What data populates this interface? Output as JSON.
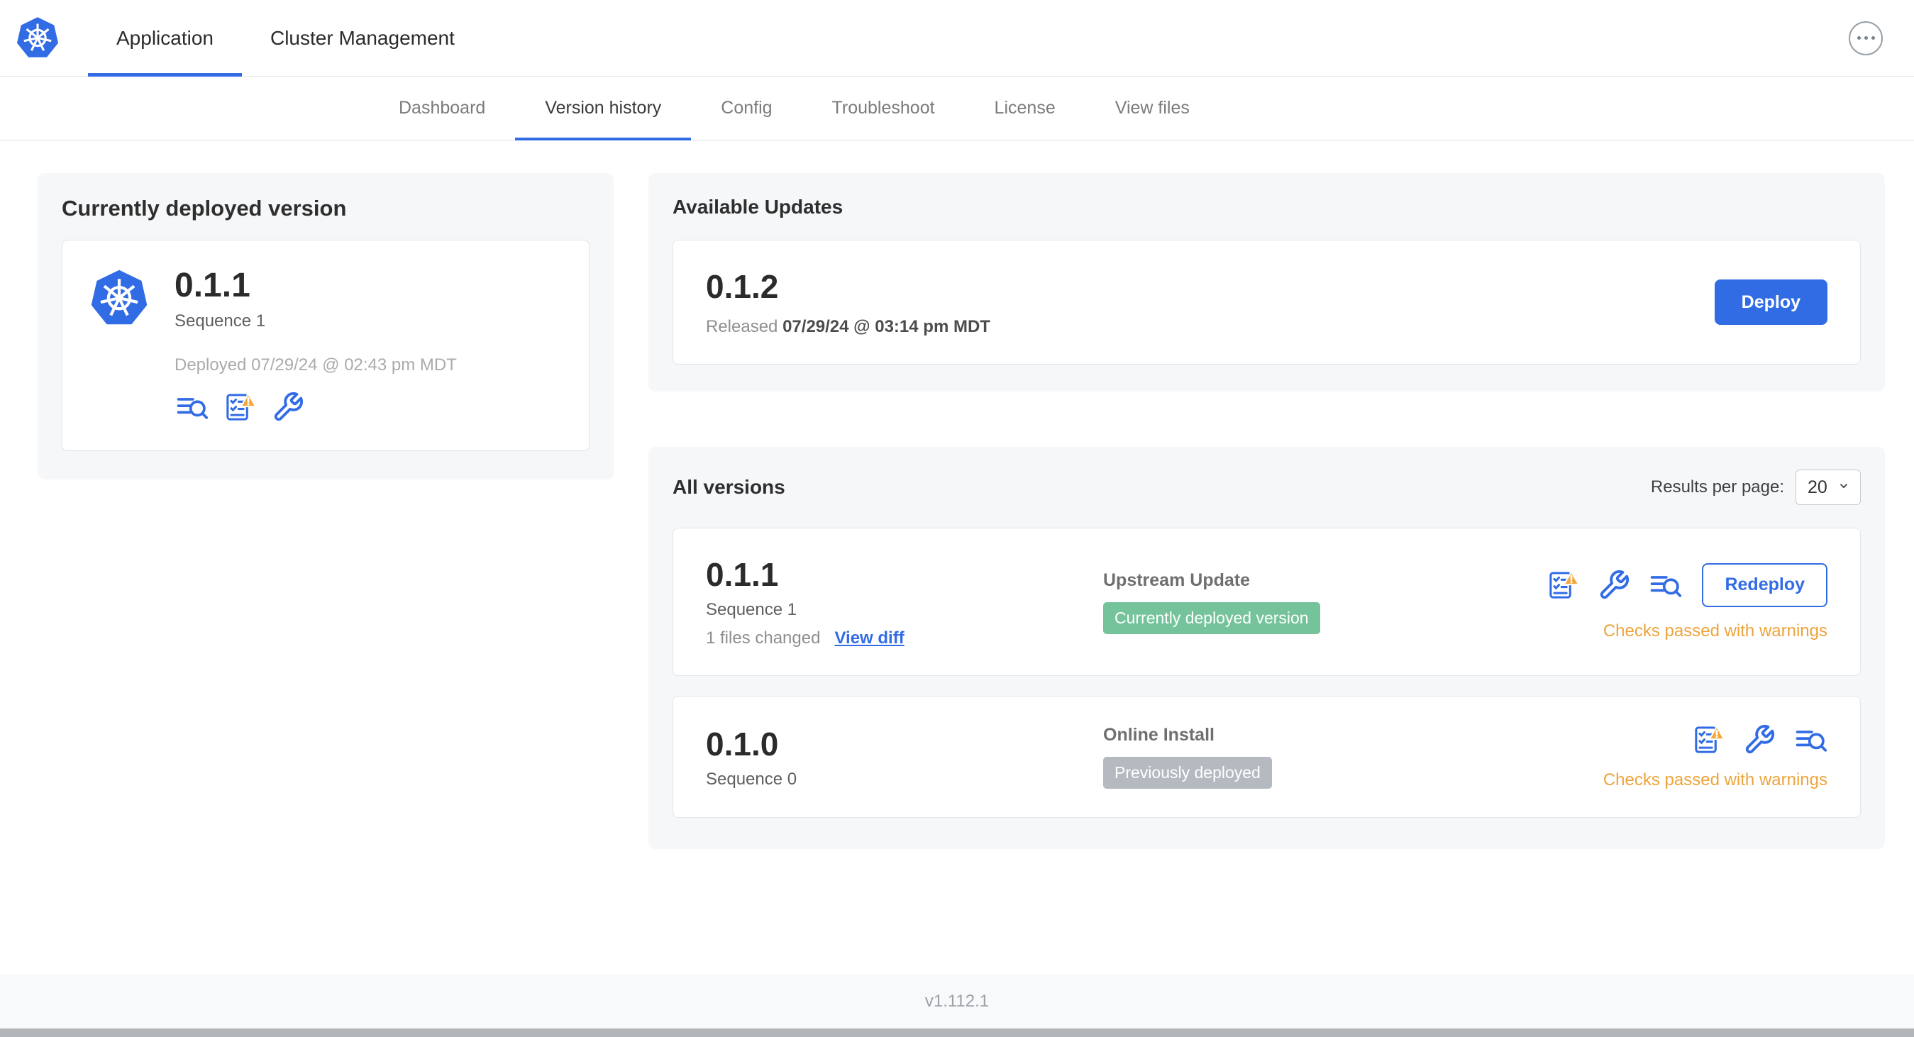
{
  "topbar": {
    "tabs": [
      {
        "label": "Application"
      },
      {
        "label": "Cluster Management"
      }
    ]
  },
  "subnav": {
    "items": [
      {
        "label": "Dashboard"
      },
      {
        "label": "Version history"
      },
      {
        "label": "Config"
      },
      {
        "label": "Troubleshoot"
      },
      {
        "label": "License"
      },
      {
        "label": "View files"
      }
    ]
  },
  "current_version": {
    "title": "Currently deployed version",
    "version": "0.1.1",
    "sequence": "Sequence 1",
    "deployed": "Deployed 07/29/24 @ 02:43 pm MDT"
  },
  "available_updates": {
    "title": "Available Updates",
    "version": "0.1.2",
    "released_prefix": "Released",
    "released_date": "07/29/24 @ 03:14 pm MDT",
    "deploy_label": "Deploy"
  },
  "all_versions": {
    "title": "All versions",
    "results_per_page_label": "Results per page:",
    "results_per_page_value": "20",
    "rows": [
      {
        "version": "0.1.1",
        "sequence": "Sequence 1",
        "files_changed": "1 files changed",
        "view_diff_label": "View diff",
        "source": "Upstream Update",
        "badge": "Currently deployed version",
        "status": "Checks passed with warnings",
        "action_label": "Redeploy"
      },
      {
        "version": "0.1.0",
        "sequence": "Sequence 0",
        "source": "Online Install",
        "badge": "Previously deployed",
        "status": "Checks passed with warnings"
      }
    ]
  },
  "footer": {
    "app_version": "v1.112.1"
  },
  "icons": {
    "logo": "kubernetes-logo",
    "overflow": "ellipsis-menu",
    "logs": "deploy-logs",
    "preflight": "preflight-checks-warning",
    "config": "config-wrench"
  },
  "colors": {
    "accent": "#326ce5",
    "badge_green": "#74c39a",
    "badge_gray": "#b4bac0",
    "warning": "#eda43b"
  }
}
